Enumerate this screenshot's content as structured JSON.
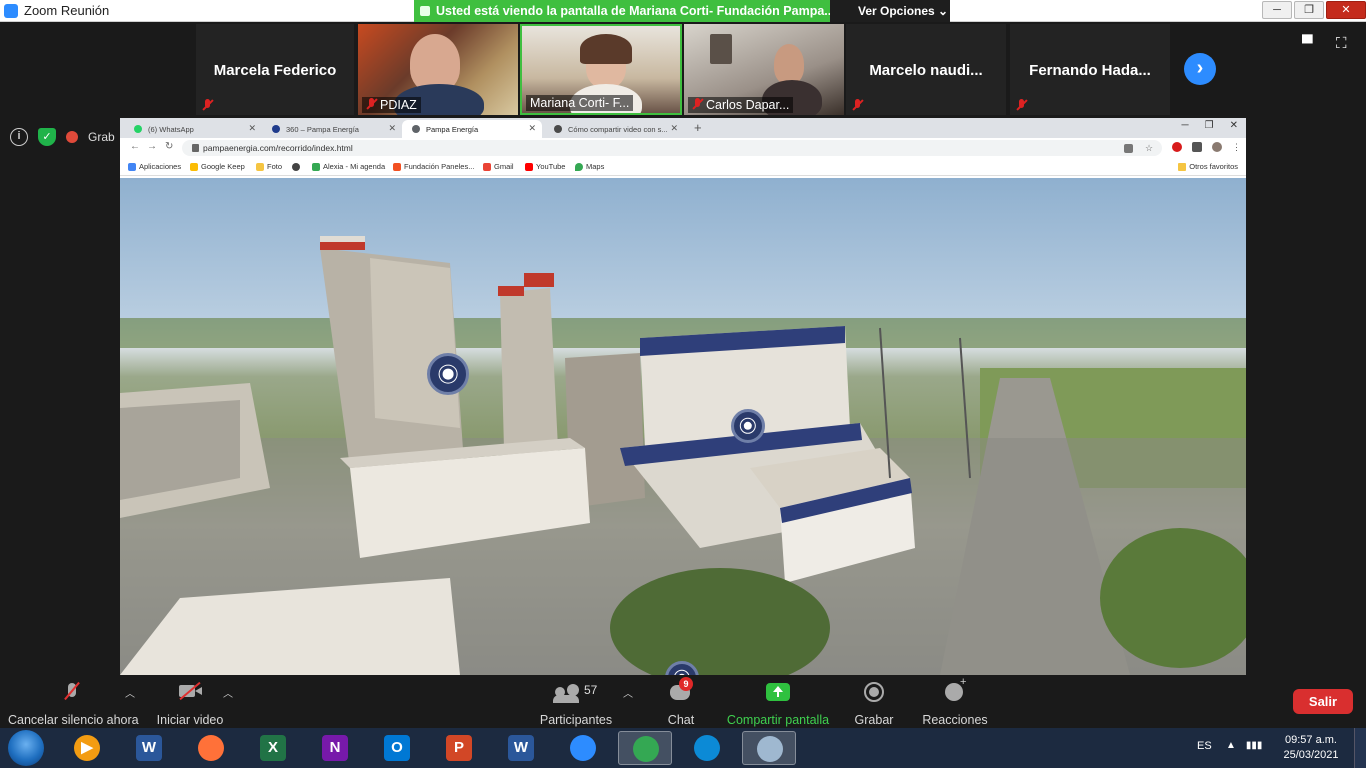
{
  "window": {
    "title": "Zoom Reunión"
  },
  "share_banner": {
    "text": "Usted está viendo la pantalla de Mariana Corti- Fundación Pampa..."
  },
  "view_options": {
    "label": "Ver Opciones",
    "caret": "⌄"
  },
  "participants_strip": [
    {
      "name": "Marcela Federico",
      "video": false,
      "muted": true
    },
    {
      "name": "PDIAZ",
      "video": true,
      "muted": true
    },
    {
      "name": "Mariana Corti- F...",
      "video": true,
      "muted": false
    },
    {
      "name": "Carlos Dapar...",
      "video": true,
      "muted": true
    },
    {
      "name": "Marcelo  naudi...",
      "video": false,
      "muted": true
    },
    {
      "name": "Fernando  Hada...",
      "video": false,
      "muted": true
    }
  ],
  "recording_status": {
    "label": "Grab"
  },
  "browser": {
    "tabs": [
      {
        "title": "(6) WhatsApp",
        "favicon_color": "#25d366"
      },
      {
        "title": "360 – Pampa Energía",
        "favicon_color": "#1f3b8c"
      },
      {
        "title": "Pampa Energía",
        "favicon_color": "#5f6368"
      },
      {
        "title": "Cómo compartir video con s...",
        "favicon_color": "#4a4a4a"
      }
    ],
    "url": "pampaenergia.com/recorrido/index.html",
    "bookmarks": [
      {
        "label": "Aplicaciones",
        "color": "#4285f4"
      },
      {
        "label": "Google Keep",
        "color": "#fbbc04"
      },
      {
        "label": "Foto",
        "color": "#f5c542"
      },
      {
        "label": "",
        "color": "#444444"
      },
      {
        "label": "Alexia - Mi agenda",
        "color": "#34a853"
      },
      {
        "label": "Fundación Paneles...",
        "color": "#f25022"
      },
      {
        "label": "Gmail",
        "color": "#ea4335"
      },
      {
        "label": "YouTube",
        "color": "#ff0000"
      },
      {
        "label": "Maps",
        "color": "#34a853"
      }
    ],
    "other_bookmarks": "Otros favoritos"
  },
  "meeting_toolbar": {
    "unmute": "Cancelar silencio ahora",
    "start_video": "Iniciar video",
    "participants": "Participantes",
    "participants_count": "57",
    "chat": "Chat",
    "chat_badge": "9",
    "share": "Compartir pantalla",
    "record": "Grabar",
    "reactions": "Reacciones",
    "leave": "Salir"
  },
  "taskbar": {
    "apps": [
      {
        "name": "media-player",
        "glyph": "▶",
        "color": "#f39c12"
      },
      {
        "name": "word",
        "glyph": "W",
        "color": "#2b579a"
      },
      {
        "name": "firefox",
        "glyph": "",
        "color": "#ff7139"
      },
      {
        "name": "excel",
        "glyph": "X",
        "color": "#217346"
      },
      {
        "name": "onenote",
        "glyph": "N",
        "color": "#7719aa"
      },
      {
        "name": "outlook",
        "glyph": "O",
        "color": "#0078d4"
      },
      {
        "name": "powerpoint",
        "glyph": "P",
        "color": "#d24726"
      },
      {
        "name": "word-2",
        "glyph": "W",
        "color": "#2b579a"
      },
      {
        "name": "zoom",
        "glyph": "",
        "color": "#2d8cff"
      },
      {
        "name": "chrome",
        "glyph": "",
        "color": "#34a853"
      },
      {
        "name": "edge",
        "glyph": "",
        "color": "#0c8ad6"
      },
      {
        "name": "paint",
        "glyph": "",
        "color": "#9fb8d0"
      }
    ],
    "language": "ES",
    "time": "09:57 a.m.",
    "date": "25/03/2021"
  }
}
